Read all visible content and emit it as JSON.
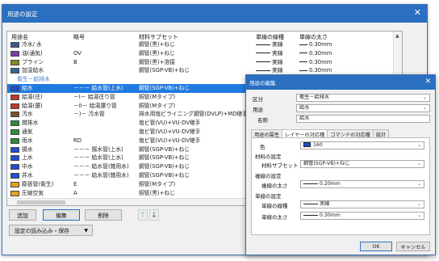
{
  "main_window": {
    "title": "用途の設定",
    "columns": [
      "用途名",
      "略号",
      "材料サブセット",
      "単線の線種",
      "単線の太さ"
    ],
    "rows": [
      {
        "type": "item",
        "color": "#3c5a8a",
        "name": "冷水/ 水",
        "abbr": "",
        "material": "鋼管(黒)+ねじ",
        "line": "実線",
        "size": "0.30mm"
      },
      {
        "type": "item",
        "color": "#7a3ea8",
        "name": "油(通気)",
        "abbr": "OV",
        "material": "鋼管(黒)+ねじ",
        "line": "実線",
        "size": "0.30mm"
      },
      {
        "type": "item",
        "color": "#8a8a1c",
        "name": "プライン",
        "abbr": "B",
        "material": "鋼管(黒)+溶接",
        "line": "実線",
        "size": "0.30mm"
      },
      {
        "type": "item",
        "color": "#2a6a9a",
        "name": "加湿給水",
        "abbr": "",
        "material": "鋼管(SGP-VB)+ねじ",
        "line": "実線",
        "size": "0.30mm"
      },
      {
        "type": "section",
        "name": "衛生－給排水"
      },
      {
        "type": "item",
        "selected": true,
        "color": "#1f4fd0",
        "name": "給水",
        "abbr": "－－－ 給水管(上水)",
        "material": "鋼管(SGP-VB)+ねじ",
        "line": "実線",
        "size": "0.20mm"
      },
      {
        "type": "item",
        "color": "#c0392b",
        "name": "給湯(往)",
        "abbr": "－I－ 給湯往り管",
        "material": "銅管(Mタイプ)",
        "line": "",
        "size": ""
      },
      {
        "type": "item",
        "color": "#c0392b",
        "name": "給湯(還)",
        "abbr": "－II－ 給湯還り管",
        "material": "銅管(Mタイプ)",
        "line": "",
        "size": ""
      },
      {
        "type": "item",
        "color": "#7a5230",
        "name": "汚水",
        "abbr": "－)－ 汚水管",
        "material": "排水用塩ビライニング鋼管(DVLP)+MD継手",
        "line": "",
        "size": ""
      },
      {
        "type": "item",
        "color": "#2e8b3a",
        "name": "雑排水",
        "abbr": "",
        "material": "塩ビ管(VU)+VU-DV継手",
        "line": "",
        "size": ""
      },
      {
        "type": "item",
        "color": "#2e8b3a",
        "name": "通気",
        "abbr": "",
        "material": "塩ビ管(VU)+VU-DV継手",
        "line": "",
        "size": ""
      },
      {
        "type": "item",
        "color": "#2e8b3a",
        "name": "雨水",
        "abbr": "RD",
        "material": "塩ビ管(VU)+VU-DV継手",
        "line": "",
        "size": ""
      },
      {
        "type": "item",
        "color": "#1f4fd0",
        "name": "揚水",
        "abbr": "－－－ 揚水管(上水)",
        "material": "鋼管(SGP-VB)+ねじ",
        "line": "",
        "size": ""
      },
      {
        "type": "item",
        "color": "#1f4fd0",
        "name": "上水",
        "abbr": "－－－ 給水管(上水)",
        "material": "鋼管(SGP-VB)+ねじ",
        "line": "",
        "size": ""
      },
      {
        "type": "item",
        "color": "#1f4fd0",
        "name": "中水",
        "abbr": "－－－ 給水管(雑用水)",
        "material": "鋼管(SGP-VB)+ねじ",
        "line": "",
        "size": ""
      },
      {
        "type": "item",
        "color": "#1f4fd0",
        "name": "井水",
        "abbr": "－－－ 給水管(雑用水)",
        "material": "鋼管(SGP-VB)+ねじ",
        "line": "",
        "size": ""
      },
      {
        "type": "item",
        "color": "#e8a020",
        "name": "膨張管(衛生)",
        "abbr": "E",
        "material": "銅管(Mタイプ)",
        "line": "",
        "size": ""
      },
      {
        "type": "item",
        "color": "#e8a020",
        "name": "圧縮空気",
        "abbr": "A",
        "material": "銅管(黒)+ねじ",
        "line": "",
        "size": ""
      }
    ],
    "buttons": {
      "add": "追加",
      "edit": "編集",
      "delete": "削除",
      "load_save": "設定の読み込み・保存"
    },
    "arrows": {
      "up": "↑",
      "down": "↓"
    }
  },
  "dialog": {
    "title": "用途の編集",
    "category_label": "区分",
    "category_value": "衛生－給排水",
    "usage_label": "用途",
    "usage_value": "給水",
    "name_label": "名称",
    "name_value": "給水",
    "tabs": [
      "用途の属性",
      "レイヤーの対応",
      "コマンドの対応",
      "設計"
    ],
    "tab_labels": [
      "用途の属性",
      "レイヤーの対応種",
      "コマンドの対応種",
      "設計"
    ],
    "color_label": "色",
    "color_value": "160",
    "material_section": "材料の設定",
    "material_subset_label": "材料サブセット",
    "material_subset_value": "鋼管(SGP-VB)+ねじ",
    "dual_section": "複線の設定",
    "dual_size_label": "複線の太さ",
    "dual_size_value": "0.20mm",
    "single_section": "単線の設定",
    "single_type_label": "単線の線種",
    "single_type_value": "実線",
    "single_size_label": "単線の太さ",
    "single_size_value": "0.30mm",
    "ok_label": "OK",
    "cancel_label": "キャンセル"
  }
}
